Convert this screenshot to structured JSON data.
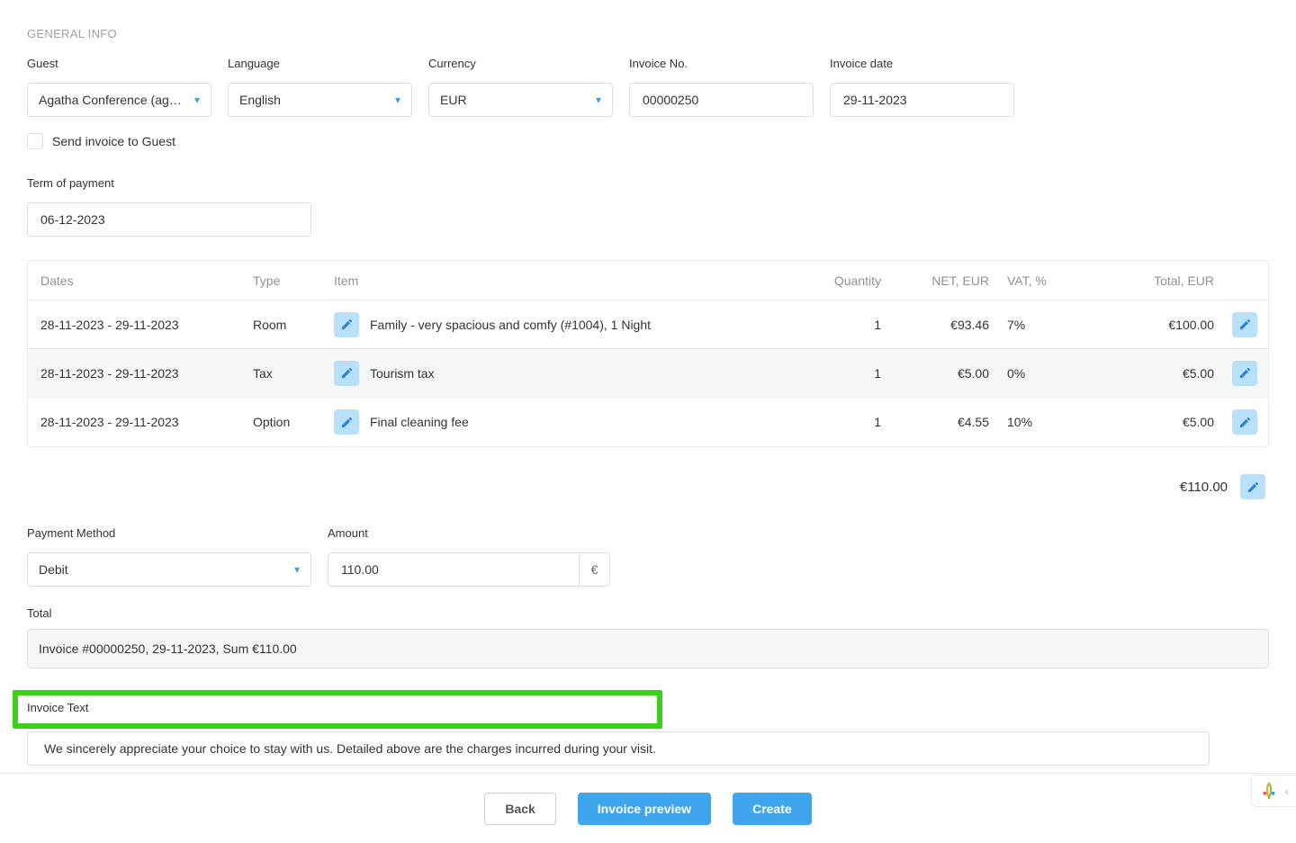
{
  "section_heading": "GENERAL INFO",
  "labels": {
    "guest": "Guest",
    "language": "Language",
    "currency": "Currency",
    "invoice_no": "Invoice No.",
    "invoice_date": "Invoice date",
    "send_invoice": "Send invoice to Guest",
    "term_of_payment": "Term of payment",
    "payment_method": "Payment Method",
    "amount": "Amount",
    "total": "Total",
    "invoice_text": "Invoice Text"
  },
  "values": {
    "guest": "Agatha Conference (agaco…",
    "language": "English",
    "currency": "EUR",
    "invoice_no": "00000250",
    "invoice_date": "29-11-2023",
    "term_of_payment": "06-12-2023",
    "payment_method": "Debit",
    "amount": "110.00",
    "currency_symbol": "€",
    "total_summary": "Invoice #00000250, 29-11-2023, Sum €110.00",
    "invoice_text": "We sincerely appreciate your choice to stay with us. Detailed above are the charges incurred during your visit."
  },
  "table": {
    "headers": {
      "dates": "Dates",
      "type": "Type",
      "item": "Item",
      "quantity": "Quantity",
      "net": "NET, EUR",
      "vat": "VAT, %",
      "total": "Total, EUR"
    },
    "rows": [
      {
        "dates": "28-11-2023 - 29-11-2023",
        "type": "Room",
        "item": "Family - very spacious and comfy  (#1004), 1 Night",
        "qty": "1",
        "net": "€93.46",
        "vat": "7%",
        "total": "€100.00"
      },
      {
        "dates": "28-11-2023 - 29-11-2023",
        "type": "Tax",
        "item": "Tourism tax",
        "qty": "1",
        "net": "€5.00",
        "vat": "0%",
        "total": "€5.00"
      },
      {
        "dates": "28-11-2023 - 29-11-2023",
        "type": "Option",
        "item": "Final cleaning fee",
        "qty": "1",
        "net": "€4.55",
        "vat": "10%",
        "total": "€5.00"
      }
    ],
    "grand_total": "€110.00"
  },
  "buttons": {
    "back": "Back",
    "preview": "Invoice preview",
    "create": "Create"
  }
}
